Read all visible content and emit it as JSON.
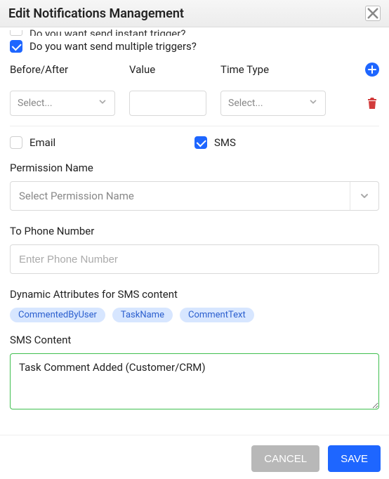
{
  "header": {
    "title": "Edit Notifications Management"
  },
  "options": {
    "instant_trigger_label": "Do you want send instant trigger?",
    "instant_trigger_checked": false,
    "multiple_trigger_label": "Do you want send multiple triggers?",
    "multiple_trigger_checked": true
  },
  "triggers": {
    "col1": "Before/After",
    "col2": "Value",
    "col3": "Time Type",
    "select_placeholder": "Select..."
  },
  "channels": {
    "email_label": "Email",
    "email_checked": false,
    "sms_label": "SMS",
    "sms_checked": true
  },
  "permission": {
    "label": "Permission Name",
    "placeholder": "Select Permission Name"
  },
  "phone": {
    "label": "To Phone Number",
    "placeholder": "Enter Phone Number",
    "value": ""
  },
  "dynamic": {
    "label": "Dynamic Attributes for SMS content",
    "chips": [
      "CommentedByUser",
      "TaskName",
      "CommentText"
    ]
  },
  "sms": {
    "label": "SMS Content",
    "value": "Task Comment Added (Customer/CRM)"
  },
  "footer": {
    "cancel": "CANCEL",
    "save": "SAVE"
  }
}
